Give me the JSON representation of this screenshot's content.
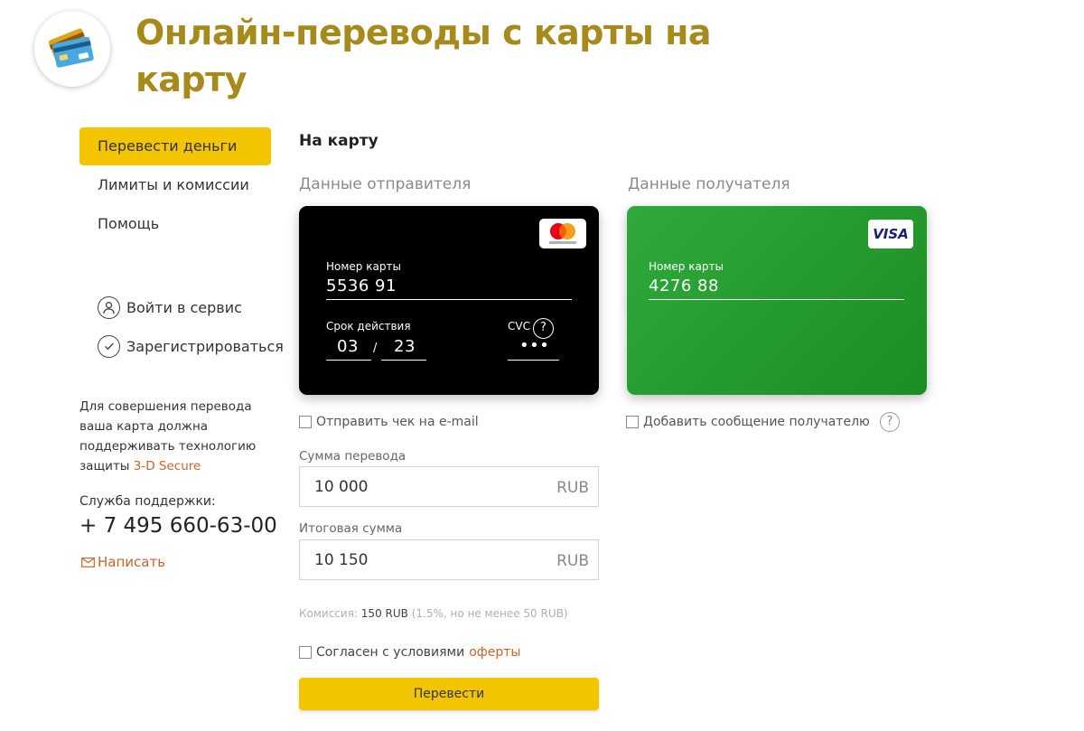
{
  "header": {
    "title": "Онлайн-переводы с карты на карту",
    "logo_icon": "cards-icon"
  },
  "sidebar": {
    "items": [
      {
        "label": "Перевести деньги",
        "active": true
      },
      {
        "label": "Лимиты и комиссии",
        "active": false
      },
      {
        "label": "Помощь",
        "active": false
      }
    ],
    "login_label": "Войти в сервис",
    "register_label": "Зарегистрироваться",
    "secure_text": "Для совершения перевода ваша карта должна поддерживать технологию защиты",
    "secure_link": "3-D Secure",
    "support_label": "Служба поддержки:",
    "support_phone": "+ 7 495 660-63-00",
    "write_label": "Написать"
  },
  "main": {
    "heading": "На карту",
    "sender": {
      "section_label": "Данные отправителя",
      "card_number_label": "Номер карты",
      "card_number": "5536 91",
      "expiry_label": "Срок действия",
      "expiry_month": "03",
      "expiry_separator": "/",
      "expiry_year": "23",
      "cvc_label": "CVC",
      "cvc_value": "•••",
      "cvc_help": "?",
      "brand": "mastercard",
      "card_color": "#000000"
    },
    "recipient": {
      "section_label": "Данные получателя",
      "card_number_label": "Номер карты",
      "card_number": "4276 88",
      "brand": "VISA",
      "card_color": "#1f9a2b"
    },
    "send_receipt_label": "Отправить чек на e-mail",
    "add_message_label": "Добавить сообщение получателю",
    "add_message_help": "?",
    "amount": {
      "label": "Сумма перевода",
      "value": "10 000",
      "currency": "RUB"
    },
    "total": {
      "label": "Итоговая сумма",
      "value": "10 150",
      "currency": "RUB"
    },
    "commission": {
      "label": "Комиссия:",
      "value": "150 RUB",
      "note": "(1.5%, но не менее 50 RUB)"
    },
    "agree_label": "Согласен с условиями",
    "agree_link": "оферты",
    "submit_label": "Перевести"
  },
  "colors": {
    "accent": "#f2c500",
    "title": "#a68a1c",
    "link": "#c8642a"
  }
}
